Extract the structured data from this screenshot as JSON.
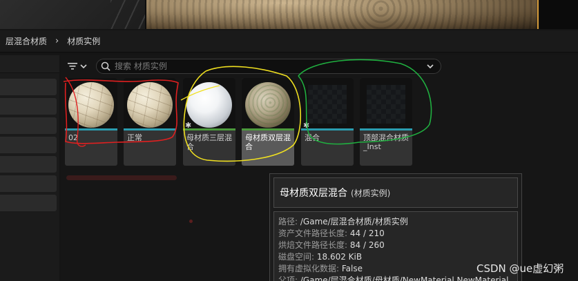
{
  "breadcrumb": {
    "items": [
      "层混合材质",
      "材质实例"
    ],
    "separator": "›"
  },
  "search": {
    "placeholder": "搜索 材质实例"
  },
  "assets": [
    {
      "name": "02",
      "thumbnail": "plaster-sphere",
      "bar_color": "#2a9db0",
      "selected": false,
      "star": false
    },
    {
      "name": "正常",
      "thumbnail": "plaster-sphere",
      "bar_color": "#2a9db0",
      "selected": false,
      "star": false
    },
    {
      "name": "母材质三层混合",
      "thumbnail": "snow-sphere",
      "bar_color": "#4c9a3c",
      "selected": false,
      "star": true
    },
    {
      "name": "母材质双层混合",
      "thumbnail": "rock-sphere",
      "bar_color": "#4c9a3c",
      "selected": true,
      "star": false
    },
    {
      "name": "混合",
      "thumbnail": "empty",
      "bar_color": "#2a9db0",
      "selected": false,
      "star": true
    },
    {
      "name": "顶部混合材质_Inst",
      "thumbnail": "empty",
      "bar_color": "#2a9db0",
      "selected": false,
      "star": false
    }
  ],
  "tooltip": {
    "title": "母材质双层混合",
    "subtitle": "(材质实例)",
    "rows": [
      {
        "key": "路径:",
        "value": "/Game/层混合材质/材质实例"
      },
      {
        "key": "资产文件路径长度:",
        "value": "44 / 210"
      },
      {
        "key": "烘焙文件路径长度:",
        "value": "84 / 260"
      },
      {
        "key": "磁盘空间:",
        "value": "18.602 KiB"
      },
      {
        "key": "拥有虚拟化数据:",
        "value": "False"
      },
      {
        "key": "父项:",
        "value": "/Game/层混合材质/母材质/NewMaterial.NewMaterial"
      }
    ]
  },
  "watermark": "CSDN @ue虚幻粥",
  "colors": {
    "instance_bar": "#2a9db0",
    "material_bar": "#4c9a3c",
    "annotation_red": "#e02020",
    "annotation_yellow": "#f0e020",
    "annotation_green": "#20b040"
  },
  "icons": {
    "filter": "filter-icon",
    "search": "search-icon",
    "chevron": "chevron-down-icon",
    "star": "star-icon",
    "breadcrumb_separator": "chevron-right-icon"
  }
}
